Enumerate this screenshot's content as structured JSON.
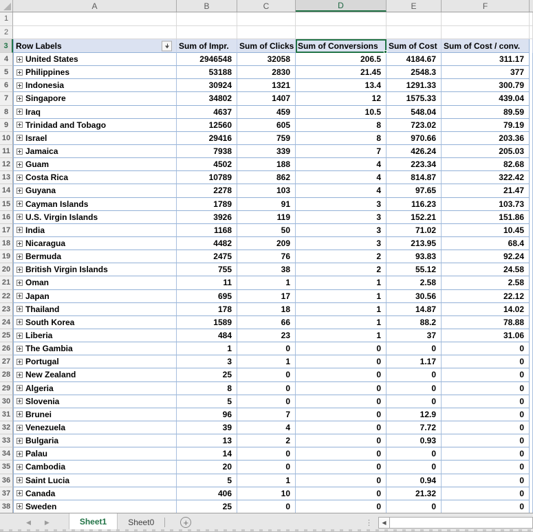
{
  "columns": {
    "letters": [
      "A",
      "B",
      "C",
      "D",
      "E",
      "F"
    ],
    "selected_letter": "D"
  },
  "rows": {
    "first_number": 1,
    "last_number": 38,
    "selected_number": 3
  },
  "pivot": {
    "row_labels_header": "Row Labels",
    "value_headers": [
      "Sum of Impr.",
      "Sum of Clicks",
      "Sum of Conversions",
      "Sum of Cost",
      "Sum of Cost / conv."
    ],
    "selected_header": "Sum of Conversions",
    "data": [
      {
        "label": "United States",
        "values": [
          "2946548",
          "32058",
          "206.5",
          "4184.67",
          "311.17"
        ]
      },
      {
        "label": "Philippines",
        "values": [
          "53188",
          "2830",
          "21.45",
          "2548.3",
          "377"
        ]
      },
      {
        "label": "Indonesia",
        "values": [
          "30924",
          "1321",
          "13.4",
          "1291.33",
          "300.79"
        ]
      },
      {
        "label": "Singapore",
        "values": [
          "34802",
          "1407",
          "12",
          "1575.33",
          "439.04"
        ]
      },
      {
        "label": "Iraq",
        "values": [
          "4637",
          "459",
          "10.5",
          "548.04",
          "89.59"
        ]
      },
      {
        "label": "Trinidad and Tobago",
        "values": [
          "12560",
          "605",
          "8",
          "723.02",
          "79.19"
        ]
      },
      {
        "label": "Israel",
        "values": [
          "29416",
          "759",
          "8",
          "970.66",
          "203.36"
        ]
      },
      {
        "label": "Jamaica",
        "values": [
          "7938",
          "339",
          "7",
          "426.24",
          "205.03"
        ]
      },
      {
        "label": "Guam",
        "values": [
          "4502",
          "188",
          "4",
          "223.34",
          "82.68"
        ]
      },
      {
        "label": "Costa Rica",
        "values": [
          "10789",
          "862",
          "4",
          "814.87",
          "322.42"
        ]
      },
      {
        "label": "Guyana",
        "values": [
          "2278",
          "103",
          "4",
          "97.65",
          "21.47"
        ]
      },
      {
        "label": "Cayman Islands",
        "values": [
          "1789",
          "91",
          "3",
          "116.23",
          "103.73"
        ]
      },
      {
        "label": "U.S. Virgin Islands",
        "values": [
          "3926",
          "119",
          "3",
          "152.21",
          "151.86"
        ]
      },
      {
        "label": "India",
        "values": [
          "1168",
          "50",
          "3",
          "71.02",
          "10.45"
        ]
      },
      {
        "label": "Nicaragua",
        "values": [
          "4482",
          "209",
          "3",
          "213.95",
          "68.4"
        ]
      },
      {
        "label": "Bermuda",
        "values": [
          "2475",
          "76",
          "2",
          "93.83",
          "92.24"
        ]
      },
      {
        "label": "British Virgin Islands",
        "values": [
          "755",
          "38",
          "2",
          "55.12",
          "24.58"
        ]
      },
      {
        "label": "Oman",
        "values": [
          "11",
          "1",
          "1",
          "2.58",
          "2.58"
        ]
      },
      {
        "label": "Japan",
        "values": [
          "695",
          "17",
          "1",
          "30.56",
          "22.12"
        ]
      },
      {
        "label": "Thailand",
        "values": [
          "178",
          "18",
          "1",
          "14.87",
          "14.02"
        ]
      },
      {
        "label": "South Korea",
        "values": [
          "1589",
          "66",
          "1",
          "88.2",
          "78.88"
        ]
      },
      {
        "label": "Liberia",
        "values": [
          "484",
          "23",
          "1",
          "37",
          "31.06"
        ]
      },
      {
        "label": "The Gambia",
        "values": [
          "1",
          "0",
          "0",
          "0",
          "0"
        ]
      },
      {
        "label": "Portugal",
        "values": [
          "3",
          "1",
          "0",
          "1.17",
          "0"
        ]
      },
      {
        "label": "New Zealand",
        "values": [
          "25",
          "0",
          "0",
          "0",
          "0"
        ]
      },
      {
        "label": "Algeria",
        "values": [
          "8",
          "0",
          "0",
          "0",
          "0"
        ]
      },
      {
        "label": "Slovenia",
        "values": [
          "5",
          "0",
          "0",
          "0",
          "0"
        ]
      },
      {
        "label": "Brunei",
        "values": [
          "96",
          "7",
          "0",
          "12.9",
          "0"
        ]
      },
      {
        "label": "Venezuela",
        "values": [
          "39",
          "4",
          "0",
          "7.72",
          "0"
        ]
      },
      {
        "label": "Bulgaria",
        "values": [
          "13",
          "2",
          "0",
          "0.93",
          "0"
        ]
      },
      {
        "label": "Palau",
        "values": [
          "14",
          "0",
          "0",
          "0",
          "0"
        ]
      },
      {
        "label": "Cambodia",
        "values": [
          "20",
          "0",
          "0",
          "0",
          "0"
        ]
      },
      {
        "label": "Saint Lucia",
        "values": [
          "5",
          "1",
          "0",
          "0.94",
          "0"
        ]
      },
      {
        "label": "Canada",
        "values": [
          "406",
          "10",
          "0",
          "21.32",
          "0"
        ]
      },
      {
        "label": "Sweden",
        "values": [
          "25",
          "0",
          "0",
          "0",
          "0"
        ]
      }
    ]
  },
  "sheet_tabs": {
    "active": "Sheet1",
    "inactive": "Sheet0",
    "add_label": "+"
  },
  "colors": {
    "accent_green": "#217346",
    "pivot_header_bg": "#DBE2F1",
    "row_border_blue": "#93B1D7"
  }
}
